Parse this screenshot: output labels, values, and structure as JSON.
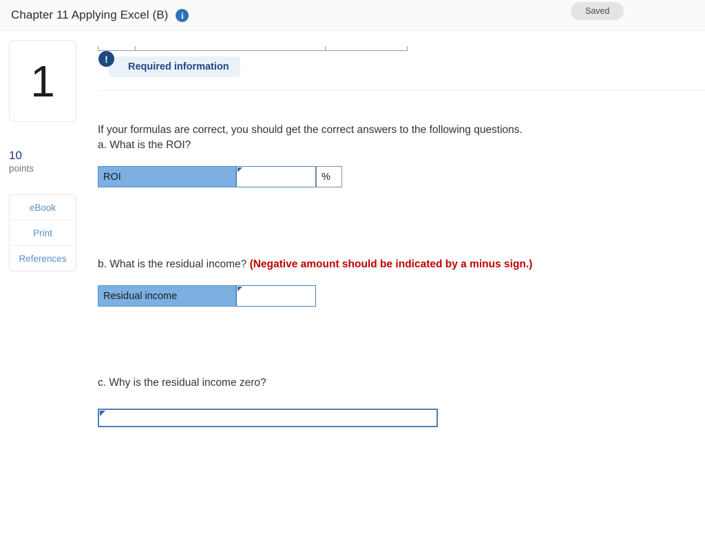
{
  "header": {
    "title": "Chapter 11 Applying Excel (B)",
    "info_icon": "info-icon",
    "info_glyph": "i",
    "saved_label": "Saved"
  },
  "sidebar": {
    "question_number": "1",
    "points_value": "10",
    "points_label": "points",
    "tools": [
      {
        "label": "eBook"
      },
      {
        "label": "Print"
      },
      {
        "label": "References"
      }
    ]
  },
  "banner": {
    "icon_glyph": "!",
    "text": "Required information"
  },
  "content": {
    "intro": "If your formulas are correct, you should get the correct answers to the following questions.",
    "question_a": "a. What is the ROI?",
    "question_b_text": "b. What is the residual income?",
    "question_b_warning": "(Negative amount should be indicated by a minus sign.)",
    "question_c": "c. Why is the residual income zero?",
    "roi_row": {
      "label": "ROI",
      "value": "",
      "unit": "%"
    },
    "residual_row": {
      "label": "Residual income",
      "value": ""
    },
    "explanation_value": ""
  },
  "colors": {
    "label_cell_blue": "#7cb0e3",
    "input_border_blue": "#4f7fb5",
    "banner_navy": "#1b4a7e",
    "warning_red": "#c00000",
    "link_blue": "#5b8ec9",
    "info_blue": "#2f72b8"
  }
}
